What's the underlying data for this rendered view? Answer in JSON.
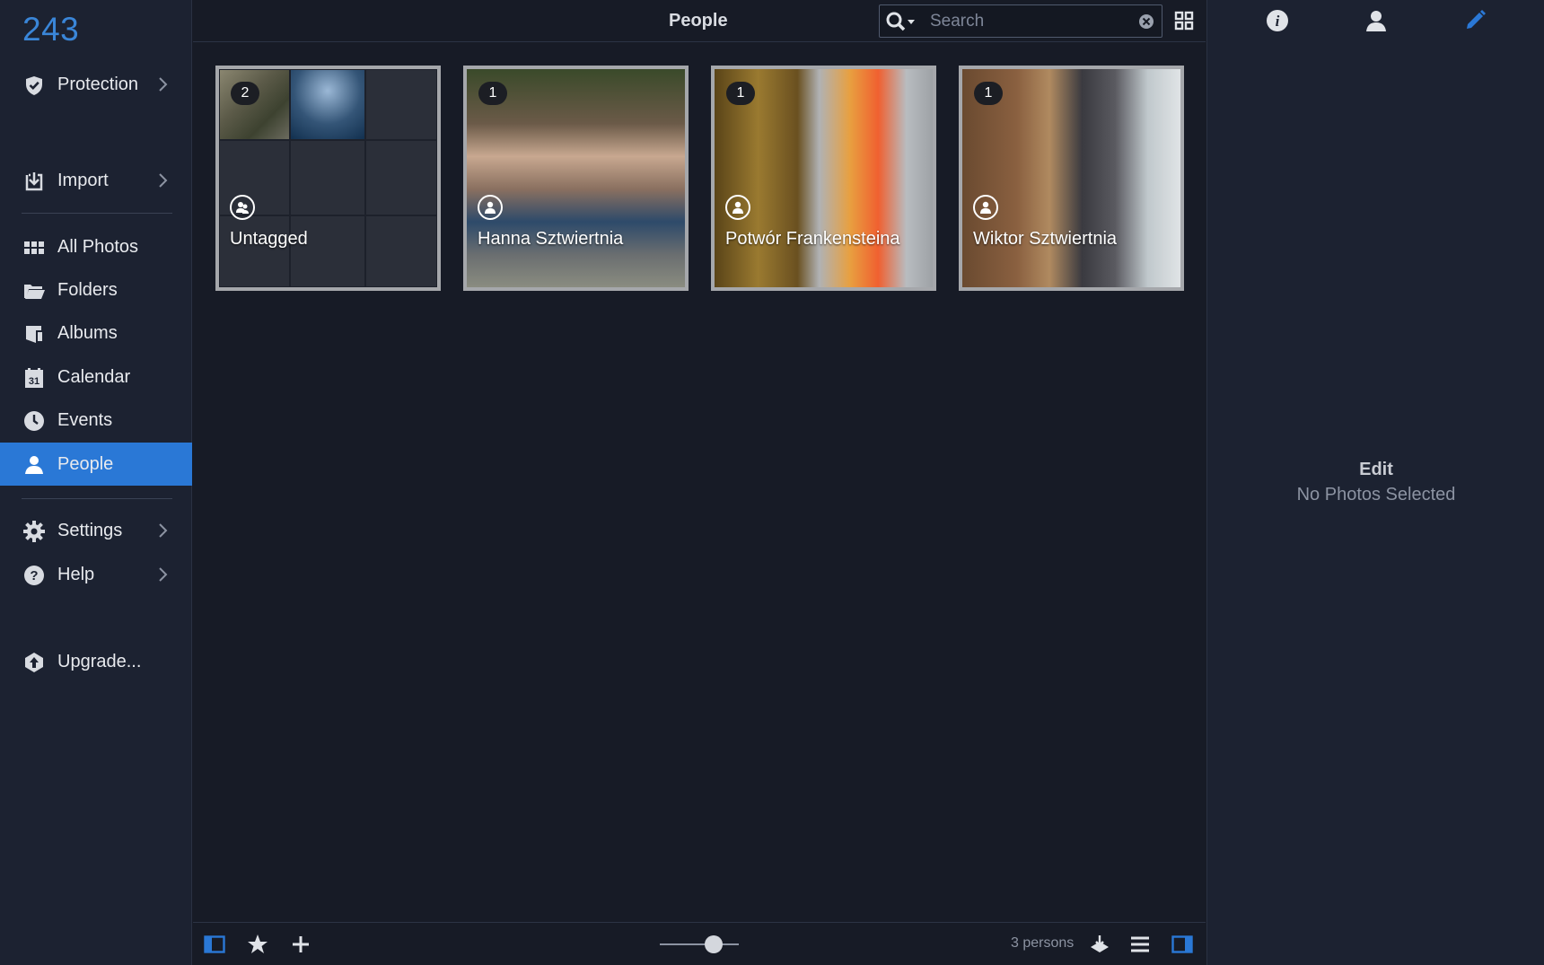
{
  "sidebar": {
    "photo_count": "243",
    "items": [
      {
        "label": "Protection",
        "icon": "shield-check-icon"
      },
      {
        "label": "Import",
        "icon": "import-icon"
      },
      {
        "label": "All Photos",
        "icon": "grid-icon"
      },
      {
        "label": "Folders",
        "icon": "folder-icon"
      },
      {
        "label": "Albums",
        "icon": "album-icon"
      },
      {
        "label": "Calendar",
        "icon": "calendar-icon"
      },
      {
        "label": "Events",
        "icon": "clock-icon"
      },
      {
        "label": "People",
        "icon": "person-icon"
      },
      {
        "label": "Settings",
        "icon": "gear-icon"
      },
      {
        "label": "Help",
        "icon": "help-icon"
      },
      {
        "label": "Upgrade...",
        "icon": "upgrade-icon"
      }
    ],
    "active": "People"
  },
  "header": {
    "title": "People",
    "search_placeholder": "Search"
  },
  "people": [
    {
      "name": "Untagged",
      "count": "2"
    },
    {
      "name": "Hanna Sztwiertnia",
      "count": "1"
    },
    {
      "name": "Potwór Frankensteina",
      "count": "1"
    },
    {
      "name": "Wiktor Sztwiertnia",
      "count": "1"
    }
  ],
  "right_panel": {
    "title": "Edit",
    "subtitle": "No Photos Selected"
  },
  "footer": {
    "status": "3 persons"
  },
  "colors": {
    "accent": "#2a78d6",
    "count_blue": "#3a86d8",
    "background": "#171b26",
    "sidebar": "#1c2231"
  }
}
